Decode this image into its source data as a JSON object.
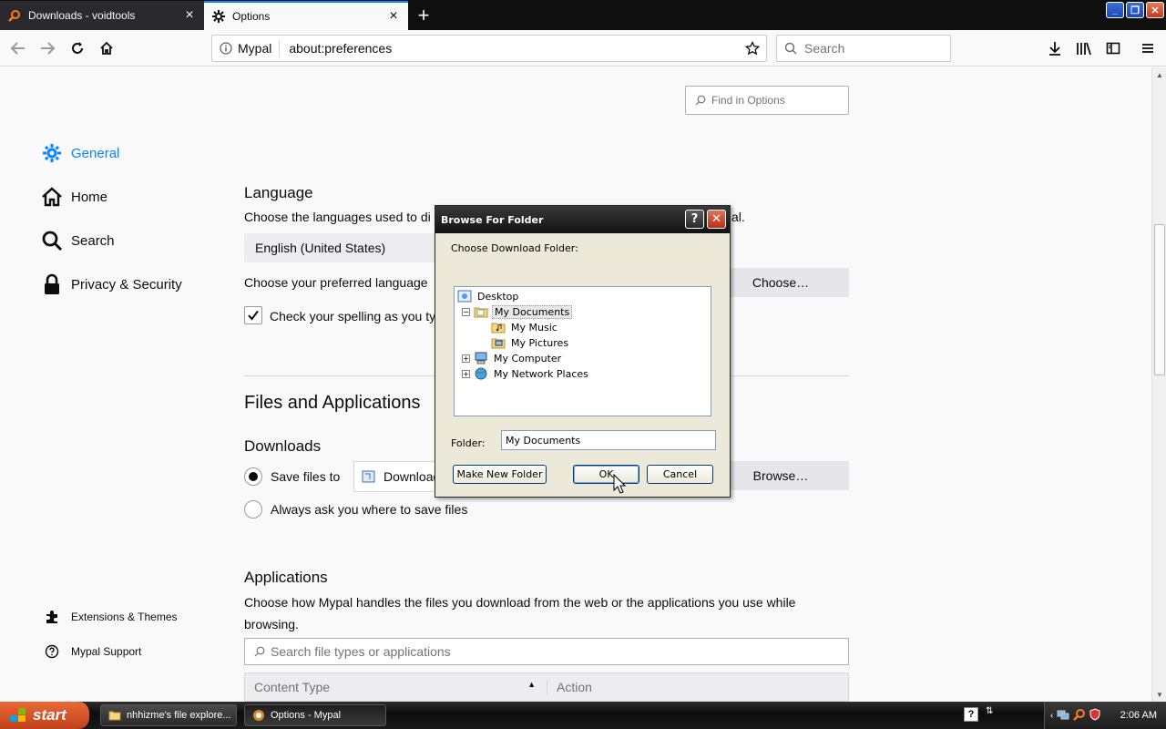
{
  "tabs": [
    {
      "title": "Downloads - voidtools",
      "icon": "search-magnifier-icon",
      "active": false
    },
    {
      "title": "Options",
      "icon": "gear-icon",
      "active": true
    }
  ],
  "urlbar": {
    "site_name": "Mypal",
    "url": "about:preferences"
  },
  "searchbar": {
    "placeholder": "Search"
  },
  "find": {
    "placeholder": "Find in Options"
  },
  "categories": [
    {
      "label": "General",
      "icon": "gear-icon",
      "selected": true
    },
    {
      "label": "Home",
      "icon": "home-icon",
      "selected": false
    },
    {
      "label": "Search",
      "icon": "search-icon",
      "selected": false
    },
    {
      "label": "Privacy & Security",
      "icon": "lock-icon",
      "selected": false
    }
  ],
  "footer_links": [
    {
      "label": "Extensions & Themes",
      "icon": "puzzle-icon"
    },
    {
      "label": "Mypal Support",
      "icon": "help-icon"
    }
  ],
  "language": {
    "heading": "Language",
    "desc": "Choose the languages used to di",
    "desc_tail": "al.",
    "selected": "English (United States)",
    "preferred_text": "Choose your preferred language",
    "choose_label": "Choose…",
    "spellcheck_label": "Check your spelling as you ty",
    "spellcheck_checked": true
  },
  "files": {
    "heading": "Files and Applications",
    "downloads_heading": "Downloads",
    "save_files_label": "Save files to",
    "download_dir": "Download",
    "browse_label": "Browse…",
    "always_ask_label": "Always ask you where to save files"
  },
  "applications": {
    "heading": "Applications",
    "desc_line1": "Choose how Mypal handles the files you download from the web or the applications you use while",
    "desc_line2": "browsing.",
    "search_placeholder": "Search file types or applications",
    "col_content_type": "Content Type",
    "col_action": "Action"
  },
  "dialog": {
    "title": "Browse For Folder",
    "prompt": "Choose Download Folder:",
    "tree": [
      {
        "label": "Desktop",
        "icon": "desktop-icon",
        "expander": "",
        "selected": false
      },
      {
        "label": "My Documents",
        "icon": "folder-icon",
        "expander": "−",
        "selected": true
      },
      {
        "label": "My Music",
        "icon": "music-folder-icon",
        "expander": "",
        "selected": false
      },
      {
        "label": "My Pictures",
        "icon": "pictures-folder-icon",
        "expander": "",
        "selected": false
      },
      {
        "label": "My Computer",
        "icon": "computer-icon",
        "expander": "+",
        "selected": false
      },
      {
        "label": "My Network Places",
        "icon": "network-icon",
        "expander": "+",
        "selected": false
      }
    ],
    "folder_label": "Folder:",
    "folder_value": "My Documents",
    "new_folder_label": "Make New Folder",
    "ok_label": "OK",
    "cancel_label": "Cancel"
  },
  "taskbar": {
    "start_label": "start",
    "tasks": [
      {
        "label": "nhhizme's file explore...",
        "icon": "folder-icon",
        "active": false
      },
      {
        "label": "Options - Mypal",
        "icon": "mypal-icon",
        "active": true
      }
    ],
    "clock": "2:06 AM"
  },
  "colors": {
    "accent": "#0a84ff",
    "dialog_title": "#1a1a1a",
    "taskbar": "#1a1a1a",
    "start": "#d2512a"
  }
}
